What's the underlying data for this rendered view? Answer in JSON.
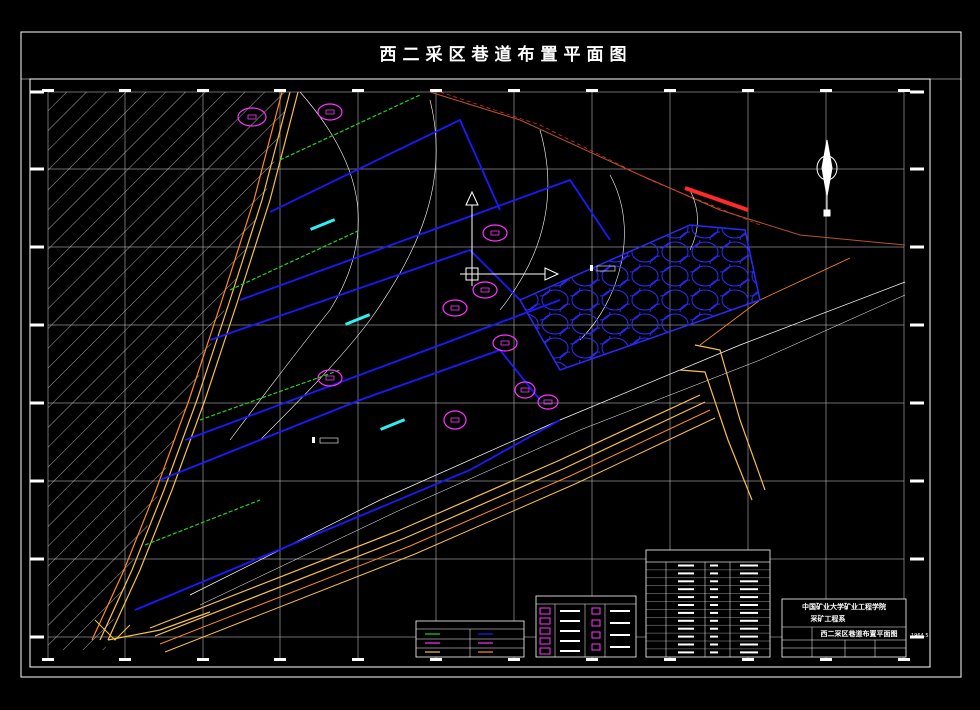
{
  "drawing": {
    "title": "西二采区巷道布置平面图",
    "scale_note": "1964.5"
  },
  "title_block": {
    "school": "中国矿业大学矿业工程学院",
    "department": "采矿工程系",
    "drawing_name": "西二采区巷道布置平面图"
  },
  "north_arrow": {
    "label": "N"
  },
  "colors": {
    "background": "#000000",
    "frame": "#ffffff",
    "grid": "#ffffff",
    "roadway_main": "#f7c04a",
    "roadway_orange": "#ff8c1a",
    "roadway_blue": "#1a1aff",
    "roadway_green": "#21d321",
    "equipment_magenta": "#ff33ff",
    "fault_red": "#ff2a2a",
    "boundary_brown": "#b5542a",
    "label_cyan": "#2ef0f0"
  },
  "icons": {
    "north_arrow": "north-arrow-icon",
    "coordinate_marker": "coordinate-marker-icon",
    "equipment": "equipment-callout-icon"
  }
}
